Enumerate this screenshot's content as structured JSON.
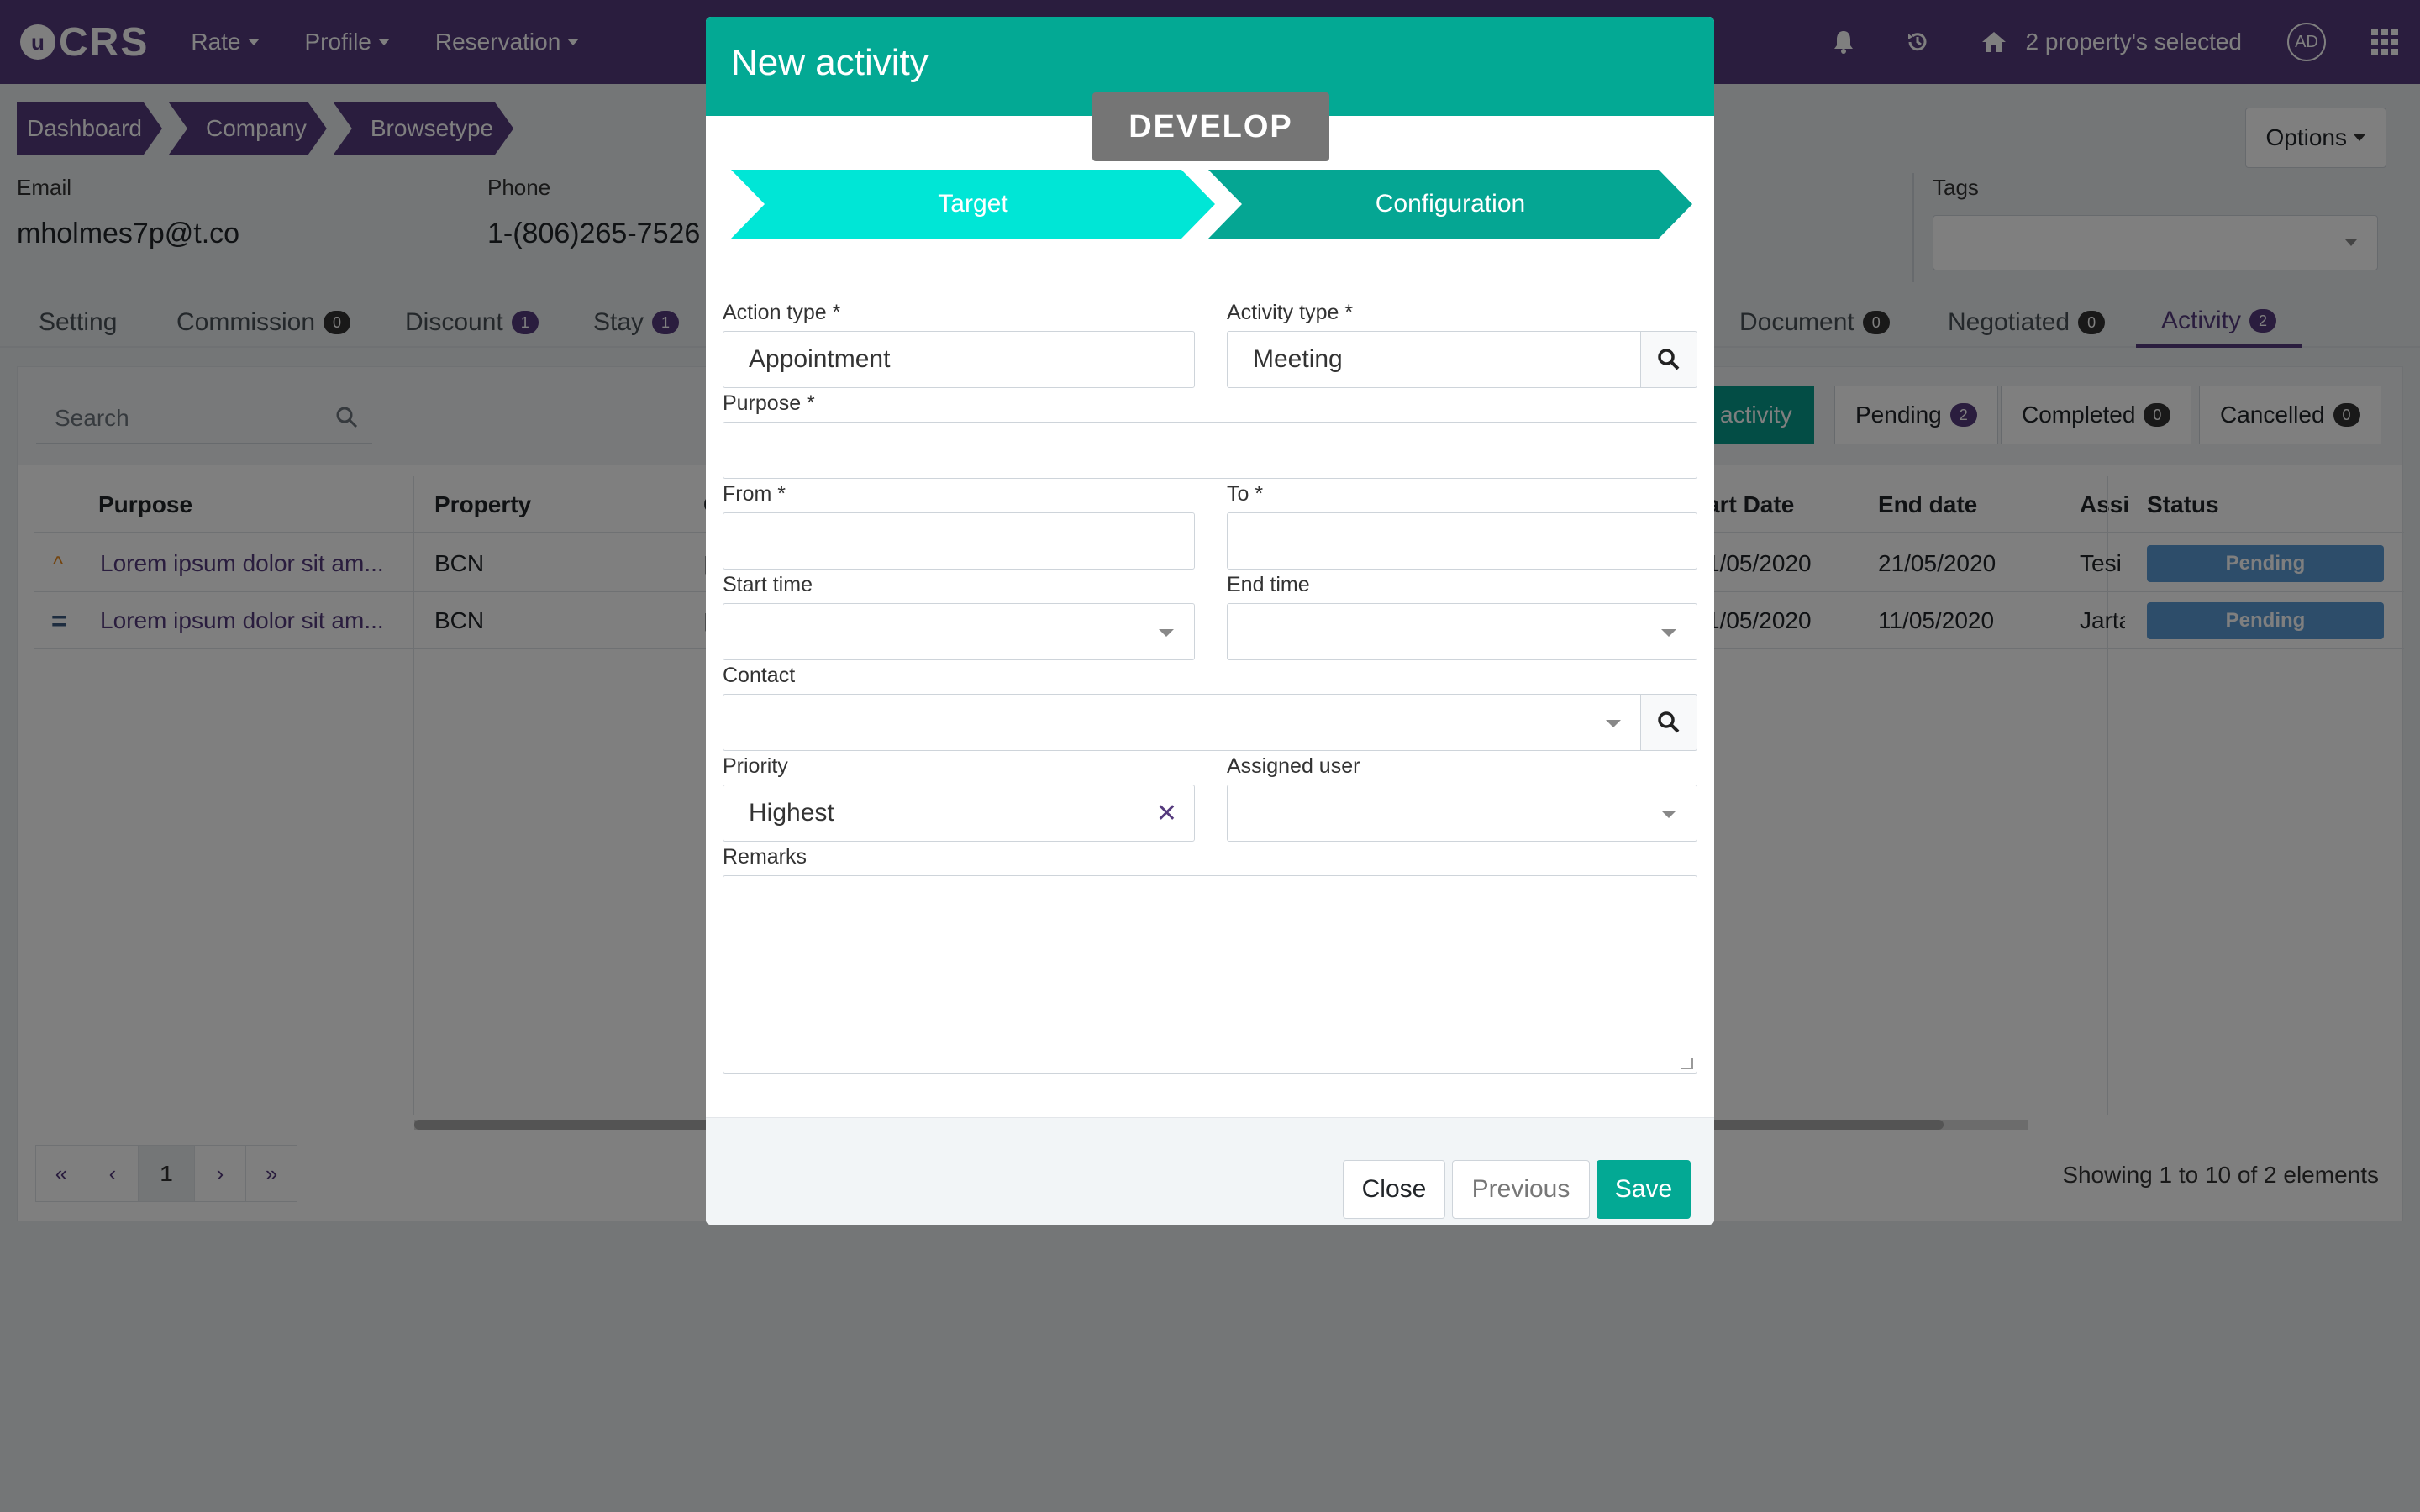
{
  "topbar": {
    "logo": "CRS",
    "nav": [
      {
        "label": "Rate"
      },
      {
        "label": "Profile"
      },
      {
        "label": "Reservation"
      }
    ],
    "property_selected": "2 property's selected",
    "avatar": "AD"
  },
  "breadcrumb": [
    "Dashboard",
    "Company",
    "Browsetype"
  ],
  "options_label": "Options",
  "info": {
    "email_label": "Email",
    "email_value": "mholmes7p@t.co",
    "phone_label": "Phone",
    "phone_value": "1-(806)265-7526",
    "tags_label": "Tags"
  },
  "tabs": [
    {
      "label": "Setting",
      "count": null
    },
    {
      "label": "Commission",
      "count": "0"
    },
    {
      "label": "Discount",
      "count": "1"
    },
    {
      "label": "Stay",
      "count": "1"
    },
    {
      "label": "Document",
      "count": "0"
    },
    {
      "label": "Negotiated",
      "count": "0"
    },
    {
      "label": "Activity",
      "count": "2"
    }
  ],
  "panel": {
    "search_placeholder": "Search",
    "new_activity_label": "activity",
    "filters": [
      {
        "label": "Pending",
        "count": "2"
      },
      {
        "label": "Completed",
        "count": "0"
      },
      {
        "label": "Cancelled",
        "count": "0"
      }
    ],
    "columns": [
      "Purpose",
      "Property",
      "O",
      "art Date",
      "End date",
      "Assi",
      "Status"
    ],
    "rows": [
      {
        "purpose": "Lorem ipsum dolor sit am...",
        "property": "BCN",
        "start": "1/05/2020",
        "end": "21/05/2020",
        "assigned": "Tesi",
        "status": "Pending",
        "priority": "high"
      },
      {
        "purpose": "Lorem ipsum dolor sit am...",
        "property": "BCN",
        "start": "1/05/2020",
        "end": "11/05/2020",
        "assigned": "Jarta",
        "status": "Pending",
        "priority": "medium"
      }
    ],
    "pagination": {
      "first": "«",
      "prev": "‹",
      "current": "1",
      "next": "›",
      "last": "»"
    },
    "showing": "Showing 1 to 10 of 2 elements"
  },
  "modal": {
    "title": "New activity",
    "env_badge": "DEVELOP",
    "steps": [
      "Target",
      "Configuration"
    ],
    "fields": {
      "action_type_label": "Action type *",
      "action_type_value": "Appointment",
      "activity_type_label": "Activity type *",
      "activity_type_value": "Meeting",
      "purpose_label": "Purpose *",
      "from_label": "From *",
      "to_label": "To *",
      "start_time_label": "Start time",
      "end_time_label": "End time",
      "contact_label": "Contact",
      "priority_label": "Priority",
      "priority_value": "Highest",
      "assigned_user_label": "Assigned user",
      "remarks_label": "Remarks"
    },
    "buttons": {
      "close": "Close",
      "previous": "Previous",
      "save": "Save"
    }
  },
  "colors": {
    "brand_purple": "#553a7d",
    "teal": "#03a994",
    "status_pending": "#5b9bd5"
  }
}
